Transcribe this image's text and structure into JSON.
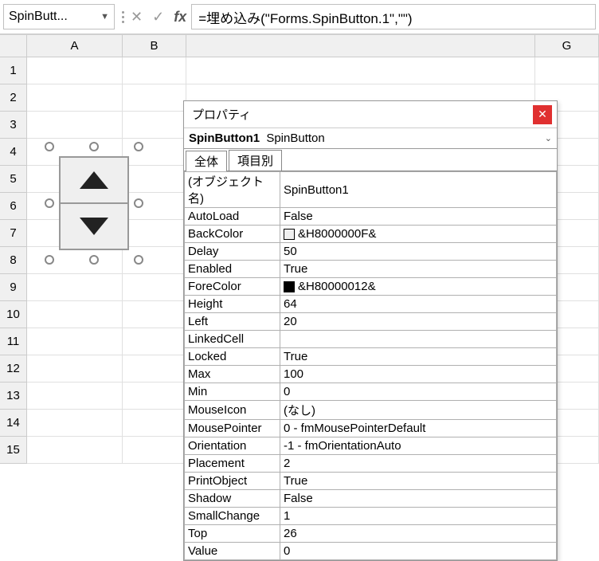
{
  "formula_bar": {
    "name_box": "SpinButt...",
    "fx_label": "fx",
    "formula": "=埋め込み(\"Forms.SpinButton.1\",\"\")"
  },
  "columns": [
    "A",
    "B",
    "G"
  ],
  "rows": [
    "1",
    "2",
    "3",
    "4",
    "5",
    "6",
    "7",
    "8",
    "9",
    "10",
    "11",
    "12",
    "13",
    "14",
    "15"
  ],
  "prop_window": {
    "title": "プロパティ",
    "close": "✕",
    "object_name": "SpinButton1",
    "object_type": "SpinButton",
    "tabs": {
      "all": "全体",
      "category": "項目別"
    },
    "props": [
      {
        "k": "(オブジェクト名)",
        "v": "SpinButton1"
      },
      {
        "k": "AutoLoad",
        "v": "False"
      },
      {
        "k": "BackColor",
        "v": "&H8000000F&",
        "swatch": "#f0f0f0"
      },
      {
        "k": "Delay",
        "v": "50"
      },
      {
        "k": "Enabled",
        "v": "True"
      },
      {
        "k": "ForeColor",
        "v": "&H80000012&",
        "swatch": "#000000"
      },
      {
        "k": "Height",
        "v": "64"
      },
      {
        "k": "Left",
        "v": "20"
      },
      {
        "k": "LinkedCell",
        "v": ""
      },
      {
        "k": "Locked",
        "v": "True"
      },
      {
        "k": "Max",
        "v": "100"
      },
      {
        "k": "Min",
        "v": "0"
      },
      {
        "k": "MouseIcon",
        "v": "(なし)"
      },
      {
        "k": "MousePointer",
        "v": "0 - fmMousePointerDefault"
      },
      {
        "k": "Orientation",
        "v": "-1 - fmOrientationAuto"
      },
      {
        "k": "Placement",
        "v": "2"
      },
      {
        "k": "PrintObject",
        "v": "True"
      },
      {
        "k": "Shadow",
        "v": "False"
      },
      {
        "k": "SmallChange",
        "v": "1"
      },
      {
        "k": "Top",
        "v": "26"
      },
      {
        "k": "Value",
        "v": "0"
      }
    ]
  }
}
